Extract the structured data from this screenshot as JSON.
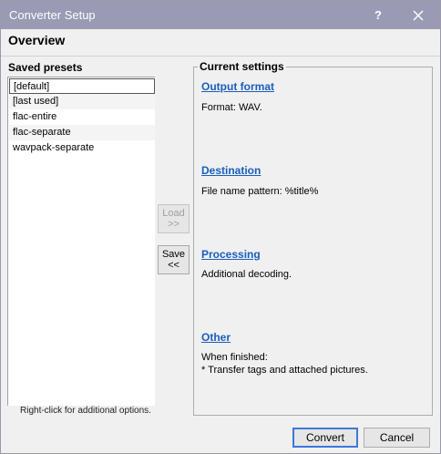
{
  "window": {
    "title": "Converter Setup",
    "help_glyph": "?"
  },
  "header": {
    "title": "Overview"
  },
  "presets": {
    "label": "Saved presets",
    "items": [
      "[default]",
      "[last used]",
      "flac-entire",
      "flac-separate",
      "wavpack-separate"
    ],
    "hint": "Right-click for additional options."
  },
  "side_buttons": {
    "load": {
      "line1": "Load",
      "line2": ">>"
    },
    "save": {
      "line1": "Save",
      "line2": "<<"
    }
  },
  "current_settings": {
    "title": "Current settings",
    "output_format": {
      "link": "Output format",
      "text": "Format: WAV."
    },
    "destination": {
      "link": "Destination",
      "text": "File name pattern: %title%"
    },
    "processing": {
      "link": "Processing",
      "text": "Additional decoding."
    },
    "other": {
      "link": "Other",
      "line1": "When finished:",
      "line2": "* Transfer tags and attached pictures."
    }
  },
  "footer": {
    "convert_label": "Convert",
    "cancel_label": "Cancel"
  }
}
